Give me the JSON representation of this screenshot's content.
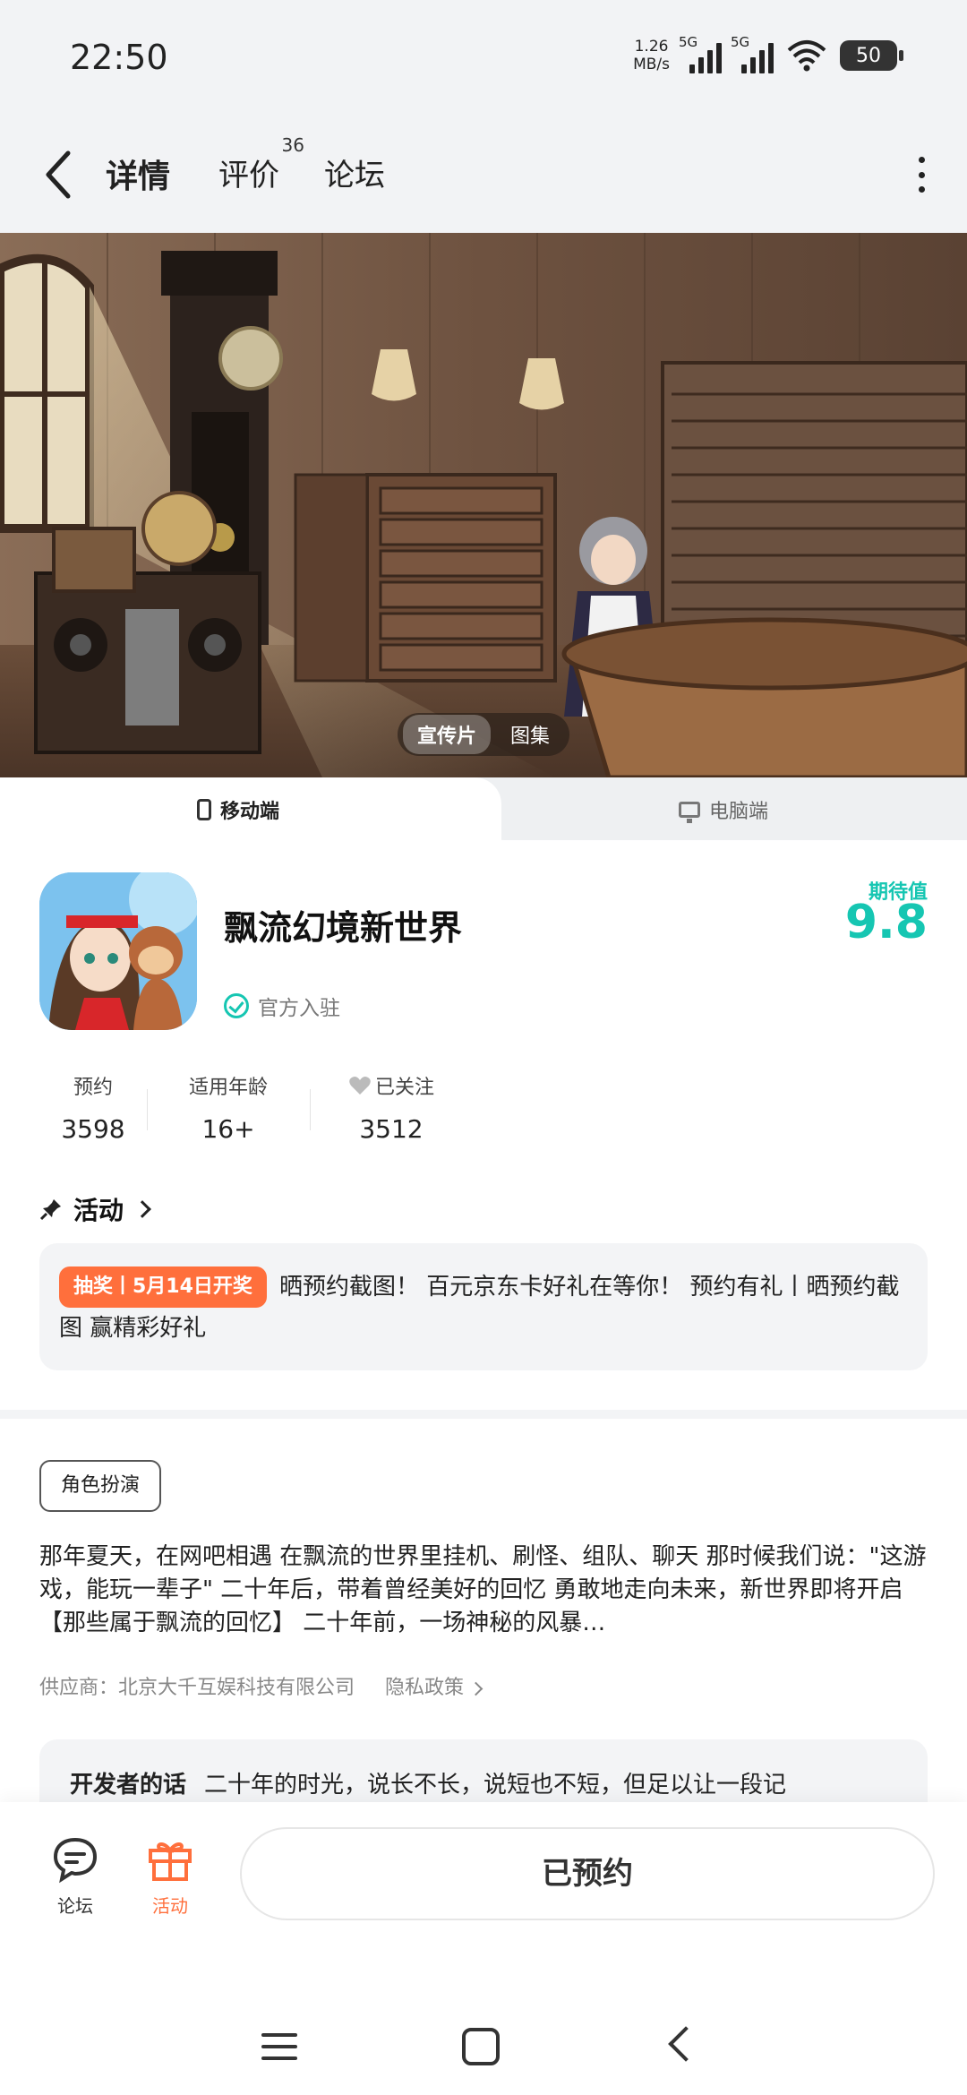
{
  "status_bar": {
    "time": "22:50",
    "net_speed": "1.26",
    "net_unit": "MB/s",
    "sim1": "5G",
    "sim2": "5G",
    "battery": "50"
  },
  "header": {
    "tabs": [
      {
        "label": "详情",
        "active": true
      },
      {
        "label": "评价",
        "badge": "36"
      },
      {
        "label": "论坛"
      }
    ]
  },
  "hero": {
    "toggle": [
      "宣传片",
      "图集"
    ],
    "active_toggle": "宣传片"
  },
  "platform_tabs": {
    "mobile": "移动端",
    "pc": "电脑端"
  },
  "game": {
    "title": "飘流幻境新世界",
    "official": "官方入驻",
    "expect_label": "期待值",
    "expect_value": "9.8"
  },
  "stats": [
    {
      "label": "预约",
      "value": "3598"
    },
    {
      "label": "适用年龄",
      "value": "16+"
    },
    {
      "label": "已关注",
      "value": "3512"
    }
  ],
  "activity": {
    "heading": "活动",
    "badge": "抽奖丨5月14日开奖",
    "text": "晒预约截图！ 百元京东卡好礼在等你！ 预约有礼丨晒预约截图 赢精彩好礼"
  },
  "genre_tag": "角色扮演",
  "description": "那年夏天，在网吧相遇 在飘流的世界里挂机、刷怪、组队、聊天 那时候我们说：\"这游戏，能玩一辈子\" 二十年后，带着曾经美好的回忆 勇敢地走向未来，新世界即将开启 【那些属于飘流的回忆】 二十年前，一场神秘的风暴…",
  "supplier": {
    "text": "供应商：北京大千互娱科技有限公司",
    "privacy": "隐私政策"
  },
  "developer_note": {
    "label": "开发者的话",
    "text": "二十年的时光，说长不长，说短也不短，但足以让一段记"
  },
  "bottom_bar": {
    "forum": "论坛",
    "activity": "活动",
    "reserved": "已预约"
  },
  "colors": {
    "accent": "#16c6b2",
    "orange": "#ff6f3c",
    "card_bg": "#f3f4f6"
  }
}
